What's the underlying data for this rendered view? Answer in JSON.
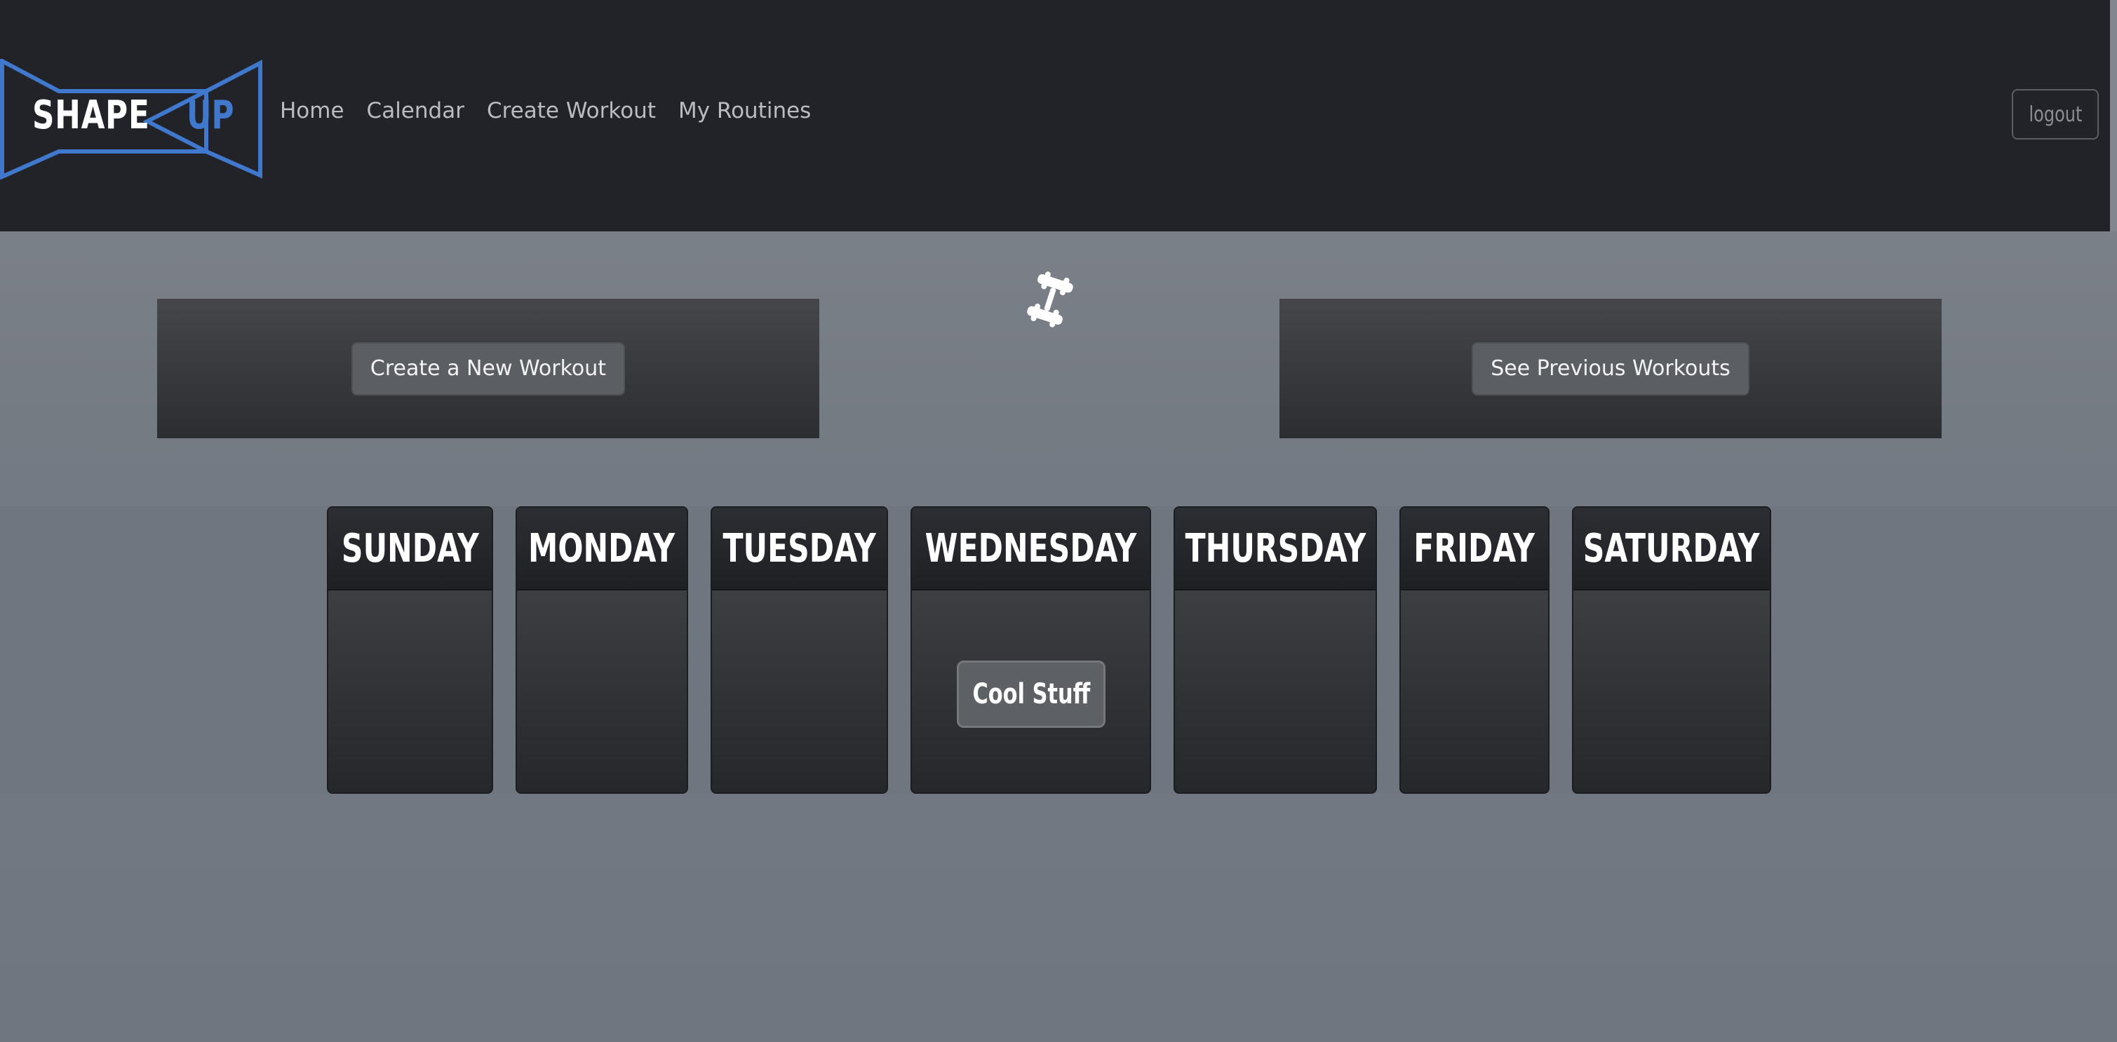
{
  "brand": {
    "shape": "SHAPE",
    "up": "UP",
    "outline_color": "#3f78cc"
  },
  "nav": {
    "items": [
      {
        "label": "Home"
      },
      {
        "label": "Calendar"
      },
      {
        "label": "Create Workout"
      },
      {
        "label": "My Routines"
      }
    ],
    "logout_label": "logout"
  },
  "actions": {
    "create_label": "Create a New Workout",
    "previous_label": "See Previous Workouts",
    "spinner_icon": "dumbbell-icon"
  },
  "week": {
    "days": [
      {
        "name": "SUNDAY",
        "workouts": []
      },
      {
        "name": "MONDAY",
        "workouts": []
      },
      {
        "name": "TUESDAY",
        "workouts": []
      },
      {
        "name": "WEDNESDAY",
        "workouts": [
          {
            "title": "Cool Stuff"
          }
        ]
      },
      {
        "name": "THURSDAY",
        "workouts": []
      },
      {
        "name": "FRIDAY",
        "workouts": []
      },
      {
        "name": "SATURDAY",
        "workouts": []
      }
    ]
  }
}
